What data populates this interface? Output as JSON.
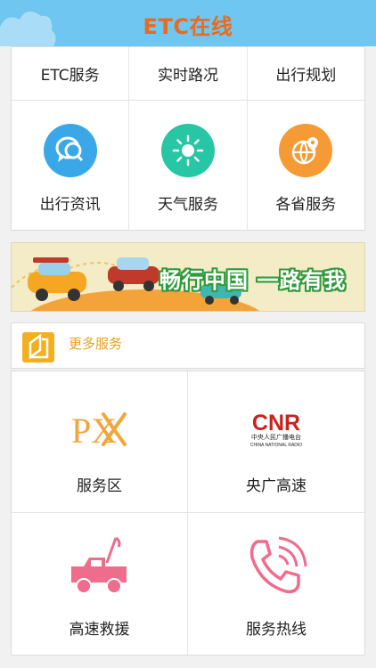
{
  "header": {
    "title": "ETC在线"
  },
  "top_links": [
    {
      "label": "ETC服务"
    },
    {
      "label": "实时路况"
    },
    {
      "label": "出行规划"
    }
  ],
  "services": [
    {
      "label": "出行资讯",
      "icon": "chat-bubbles-icon",
      "color": "#39a7e8"
    },
    {
      "label": "天气服务",
      "icon": "sun-icon",
      "color": "#27c6a4"
    },
    {
      "label": "各省服务",
      "icon": "globe-pin-icon",
      "color": "#f59a34"
    }
  ],
  "banner": {
    "slogan": "畅行中国 一路有我"
  },
  "more": {
    "title": "更多服务",
    "accent": "#e9a21b"
  },
  "grid": [
    {
      "label": "服务区",
      "icon": "px-fork-knife-icon",
      "logo_text": "PX"
    },
    {
      "label": "央广高速",
      "icon": "cnr-logo-icon",
      "logo_text": "CNR",
      "logo_sub": "中央人民广播电台",
      "logo_sub2": "CHINA NATIONAL RADIO"
    },
    {
      "label": "高速救援",
      "icon": "tow-truck-icon",
      "color": "#f06c8c"
    },
    {
      "label": "服务热线",
      "icon": "phone-icon",
      "color": "#f06c8c"
    }
  ]
}
